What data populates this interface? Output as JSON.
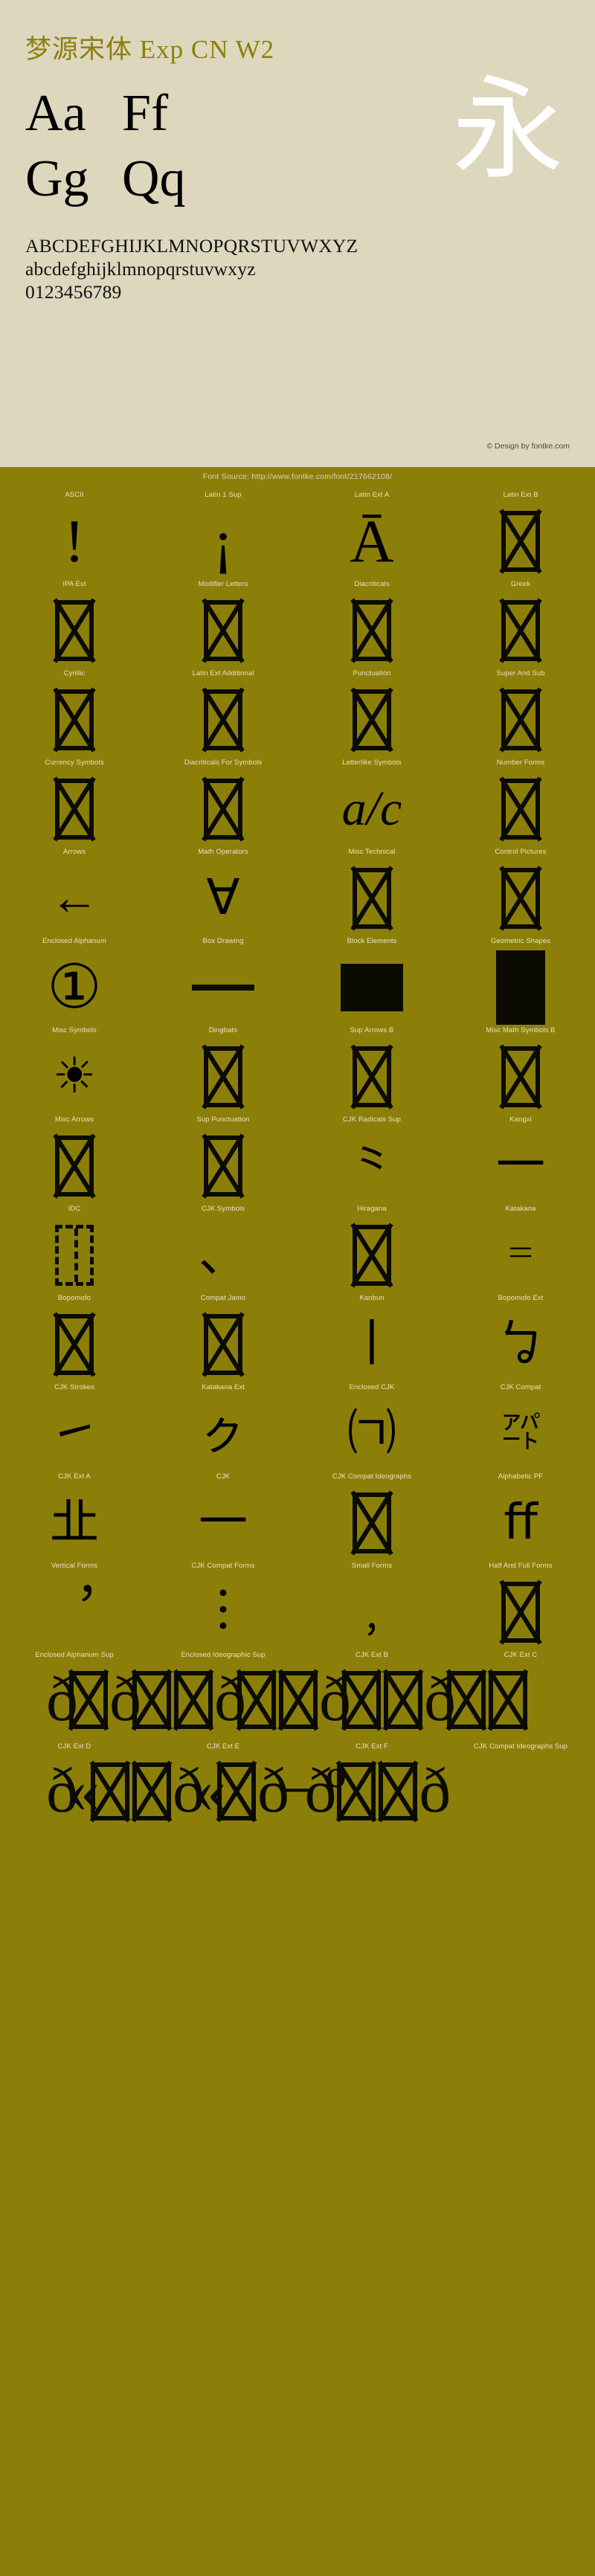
{
  "header": {
    "title": "梦源宋体 Exp CN W2",
    "samples": [
      "Aa",
      "Ff",
      "Gg",
      "Qq"
    ],
    "cjk_sample": "永",
    "alphabet_upper": "ABCDEFGHIJKLMNOPQRSTUVWXYZ",
    "alphabet_lower": "abcdefghijklmnopqrstuvwxyz",
    "digits": "0123456789",
    "credit": "© Design by fontke.com"
  },
  "source_bar": {
    "text": "Font Source: http://www.fontke.com/font/217662108/"
  },
  "blocks": [
    {
      "label": "ASCII",
      "glyph": "!",
      "kind": "text-xl"
    },
    {
      "label": "Latin 1 Sup",
      "glyph": "¡",
      "kind": "text-xl"
    },
    {
      "label": "Latin Ext A",
      "glyph": "Ā",
      "kind": "text-xl"
    },
    {
      "label": "Latin Ext B",
      "glyph": "",
      "kind": "notdef"
    },
    {
      "label": "IPA Ext",
      "glyph": "",
      "kind": "notdef"
    },
    {
      "label": "Modifier Letters",
      "glyph": "",
      "kind": "notdef"
    },
    {
      "label": "Diacriticals",
      "glyph": "",
      "kind": "notdef"
    },
    {
      "label": "Greek",
      "glyph": "",
      "kind": "notdef"
    },
    {
      "label": "Cyrillic",
      "glyph": "",
      "kind": "notdef"
    },
    {
      "label": "Latin Ext Additional",
      "glyph": "",
      "kind": "notdef"
    },
    {
      "label": "Punctuation",
      "glyph": "",
      "kind": "notdef"
    },
    {
      "label": "Super And Sub",
      "glyph": "",
      "kind": "notdef"
    },
    {
      "label": "Currency Symbols",
      "glyph": "",
      "kind": "notdef"
    },
    {
      "label": "Diacriticals For Symbols",
      "glyph": "",
      "kind": "notdef"
    },
    {
      "label": "Letterlike Symbols",
      "glyph": "a/c",
      "kind": "text-italic"
    },
    {
      "label": "Number Forms",
      "glyph": "",
      "kind": "notdef"
    },
    {
      "label": "Arrows",
      "glyph": "←",
      "kind": "text-lg"
    },
    {
      "label": "Math Operators",
      "glyph": "∀",
      "kind": "text-lg"
    },
    {
      "label": "Misc Technical",
      "glyph": "",
      "kind": "notdef"
    },
    {
      "label": "Control Pictures",
      "glyph": "",
      "kind": "notdef"
    },
    {
      "label": "Enclosed Alphanum",
      "glyph": "①",
      "kind": "text-xl"
    },
    {
      "label": "Box Drawing",
      "glyph": "",
      "kind": "boxdraw"
    },
    {
      "label": "Block Elements",
      "glyph": "",
      "kind": "block-solid"
    },
    {
      "label": "Geometric Shapes",
      "glyph": "",
      "kind": "geo-solid"
    },
    {
      "label": "Misc Symbols",
      "glyph": "☀",
      "kind": "text-lg"
    },
    {
      "label": "Dingbats",
      "glyph": "",
      "kind": "notdef"
    },
    {
      "label": "Sup Arrows B",
      "glyph": "",
      "kind": "notdef"
    },
    {
      "label": "Misc Math Symbols B",
      "glyph": "",
      "kind": "notdef"
    },
    {
      "label": "Misc Arrows",
      "glyph": "",
      "kind": "notdef"
    },
    {
      "label": "Sup Punctuation",
      "glyph": "",
      "kind": "notdef"
    },
    {
      "label": "CJK Radicals Sup",
      "glyph": "⺀",
      "kind": "text-lg"
    },
    {
      "label": "Kangxi",
      "glyph": "一",
      "kind": "text-lg"
    },
    {
      "label": "IDC",
      "glyph": "",
      "kind": "idc"
    },
    {
      "label": "CJK Symbols",
      "glyph": "、",
      "kind": "text-lg"
    },
    {
      "label": "Hiragana",
      "glyph": "",
      "kind": "notdef"
    },
    {
      "label": "Katakana",
      "glyph": "゠",
      "kind": "text-lg"
    },
    {
      "label": "Bopomofo",
      "glyph": "",
      "kind": "notdef"
    },
    {
      "label": "Compat Jamo",
      "glyph": "",
      "kind": "notdef"
    },
    {
      "label": "Kanbun",
      "glyph": "丨",
      "kind": "text-lg"
    },
    {
      "label": "Bopomofo Ext",
      "glyph": "ㆠ",
      "kind": "text-lg"
    },
    {
      "label": "CJK Strokes",
      "glyph": "㇀",
      "kind": "text-lg"
    },
    {
      "label": "Katakana Ext",
      "glyph": "ㇰ",
      "kind": "text-lg"
    },
    {
      "label": "Enclosed CJK",
      "glyph": "㈀",
      "kind": "text-lg"
    },
    {
      "label": "CJK Compat",
      "glyph": "㌀",
      "kind": "text-md"
    },
    {
      "label": "CJK Ext A",
      "glyph": "㐀",
      "kind": "text-lg"
    },
    {
      "label": "CJK",
      "glyph": "一",
      "kind": "text-lg"
    },
    {
      "label": "CJK Compat Ideographs",
      "glyph": "",
      "kind": "notdef"
    },
    {
      "label": "Alphabetic PF",
      "glyph": "ﬀ",
      "kind": "text-lg"
    },
    {
      "label": "Vertical Forms",
      "glyph": "︐",
      "kind": "text-lg"
    },
    {
      "label": "CJK Compat Forms",
      "glyph": "︙",
      "kind": "text-lg"
    },
    {
      "label": "Small Forms",
      "glyph": "﹐",
      "kind": "text-lg"
    },
    {
      "label": "Half And Full Forms",
      "glyph": "",
      "kind": "notdef"
    }
  ],
  "wide_rows": [
    {
      "labels": [
        "Enclosed Alphanum Sup",
        "Enclosed Ideographic Sup",
        "CJK Ext B",
        "CJK Ext C"
      ],
      "strip": "𝕒"
    },
    {
      "labels": [
        "CJK Ext D",
        "CJK Ext E",
        "CJK Ext F",
        "CJK Compat Ideographs Sup"
      ],
      "strip": "𝕓"
    }
  ]
}
